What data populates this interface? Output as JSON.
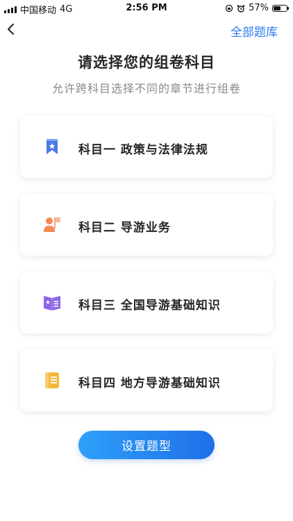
{
  "status_bar": {
    "carrier": "中国移动",
    "network": "4G",
    "time": "2:56 PM",
    "battery": "57%",
    "battery_level": 0.57
  },
  "nav": {
    "right_label": "全部题库"
  },
  "header": {
    "title": "请选择您的组卷科目",
    "subtitle": "允许跨科目选择不同的章节进行组卷"
  },
  "subjects": [
    {
      "label": "科目一 政策与法律法规",
      "icon": "bookmark-star-icon",
      "color": "#4a79e8"
    },
    {
      "label": "科目二 导游业务",
      "icon": "guide-flag-icon",
      "color": "#f48a54"
    },
    {
      "label": "科目三 全国导游基础知识",
      "icon": "book-star-icon",
      "color": "#8a66e6"
    },
    {
      "label": "科目四 地方导游基础知识",
      "icon": "notebook-icon",
      "color": "#f4b73c"
    }
  ],
  "action": {
    "button_label": "设置题型"
  },
  "colors": {
    "accent": "#2d7cf0",
    "button_start": "#2ea0f8",
    "button_end": "#1f6fe8"
  }
}
